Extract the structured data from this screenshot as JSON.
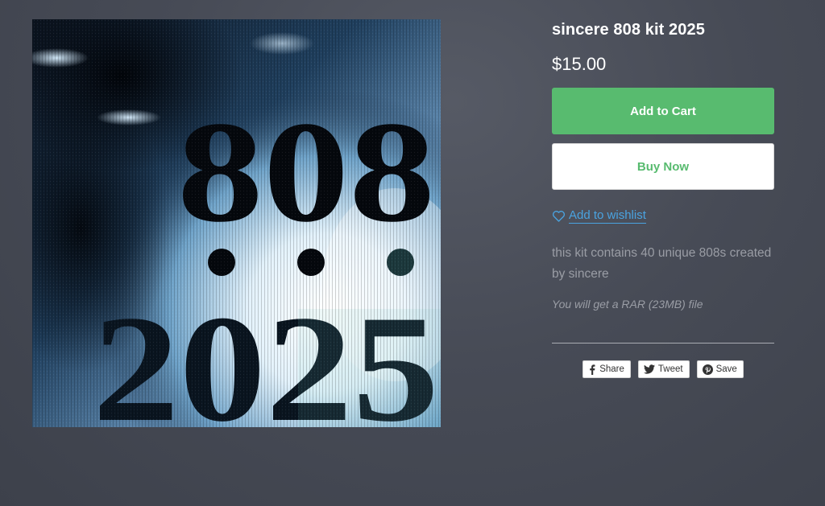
{
  "product": {
    "title": "sincere 808 kit 2025",
    "price": "$15.00",
    "image": {
      "top_text": "808",
      "bottom_text": "2025"
    }
  },
  "actions": {
    "add_to_cart": "Add to Cart",
    "buy_now": "Buy Now",
    "wishlist": "Add to wishlist"
  },
  "description": {
    "text": "this kit contains 40 unique 808s created by sincere",
    "file_note": "You will get a RAR (23MB) file"
  },
  "share": {
    "buttons": [
      {
        "label": "Share",
        "icon": "facebook-icon"
      },
      {
        "label": "Tweet",
        "icon": "twitter-icon"
      },
      {
        "label": "Save",
        "icon": "pinterest-icon"
      }
    ]
  },
  "colors": {
    "background": "#474b56",
    "add_to_cart_bg": "#58bb6f",
    "buy_now_text": "#58bb6f",
    "link": "#4aa3e0",
    "muted_text": "#9a9da5"
  }
}
